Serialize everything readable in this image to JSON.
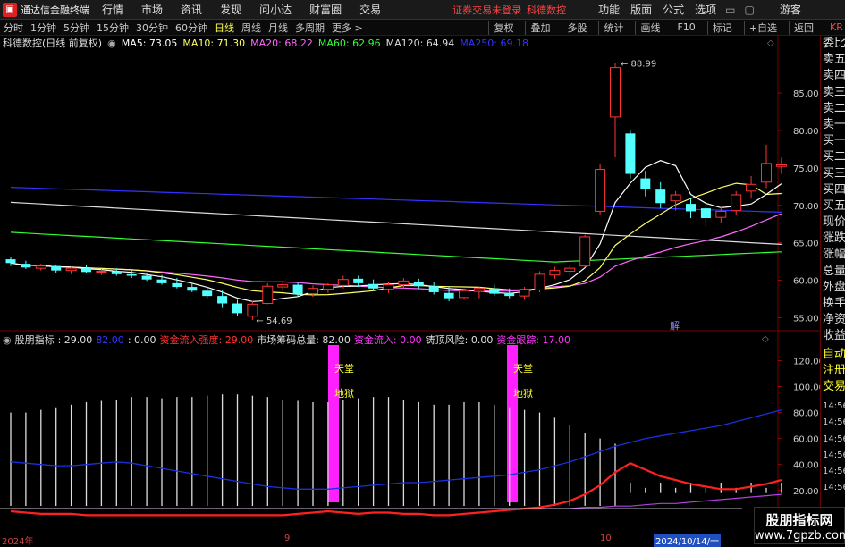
{
  "titlebar": {
    "app": "通达信金融终端",
    "menus": [
      "行情",
      "市场",
      "资讯",
      "发现",
      "问小达",
      "财富圈",
      "交易"
    ],
    "warning": "证券交易未登录",
    "stock": "科德数控",
    "right_menus": [
      "功能",
      "版面",
      "公式",
      "选项"
    ],
    "user": "游客"
  },
  "toolbar": {
    "periods": [
      "分时",
      "1分钟",
      "5分钟",
      "15分钟",
      "30分钟",
      "60分钟",
      "日线",
      "周线",
      "月线",
      "多周期",
      "更多 >"
    ],
    "active": "日线",
    "right_buttons": [
      "复权",
      "叠加",
      "多股",
      "统计",
      "画线",
      "F10",
      "标记",
      "+自选",
      "返回"
    ]
  },
  "info": {
    "name": "科德数控(日线 前复权)",
    "ma5": "MA5: 73.05",
    "ma10": "MA10: 71.30",
    "ma20": "MA20: 68.22",
    "ma60": "MA60: 62.96",
    "ma120": "MA120: 64.94",
    "ma250": "MA250: 69.18",
    "colors": {
      "ma5": "#ffffff",
      "ma10": "#ffff66",
      "ma20": "#ff66ff",
      "ma60": "#33ff33",
      "ma120": "#dddddd",
      "ma250": "#3333ff"
    }
  },
  "sidebar": {
    "labels": [
      "委比",
      "卖五",
      "卖四",
      "卖三",
      "卖二",
      "卖一",
      "买一",
      "买二",
      "买三",
      "买四",
      "买五",
      "现价",
      "涨跌",
      "涨幅",
      "总量",
      "外盘",
      "换手",
      "净资",
      "收益",
      "自动",
      "注册",
      "交易"
    ],
    "times": [
      "14:56",
      "14:56",
      "14:56",
      "14:56",
      "14:56",
      "14:56",
      "14:56",
      "14:56"
    ],
    "kr": "KR"
  },
  "indicator_bar": {
    "name": "股朋指标",
    "v1": ": 29.00",
    "v2": "82.00",
    "v3": ": 0.00",
    "t1": "资金流入强度: 29.00",
    "t2": "市场筹码总量: 82.00",
    "t3": "资金流入: 0.00",
    "t4": "铸顶风险: 0.00",
    "t5": "资金跟踪: 17.00"
  },
  "annotations": {
    "heaven": "天堂",
    "hell": "地狱",
    "hi": "88.99",
    "lo": "54.69",
    "jie": "解"
  },
  "bottom": {
    "year": "2024年",
    "sep": "9",
    "oct": "10",
    "date": "2024/10/14/一"
  },
  "watermark": {
    "line1": "股朋指标网",
    "line2": "www.7gpzb.com"
  },
  "chart_data": [
    {
      "type": "candlestick",
      "ylim": [
        53.5,
        90.5
      ],
      "yticks": [
        55.0,
        60.0,
        65.0,
        70.0,
        75.0,
        80.0,
        85.0
      ],
      "ohlc": [
        [
          62.8,
          63.1,
          61.9,
          62.3
        ],
        [
          62.2,
          62.6,
          61.5,
          61.7
        ],
        [
          61.6,
          62.2,
          61.3,
          61.9
        ],
        [
          61.9,
          62.1,
          61.0,
          61.3
        ],
        [
          61.3,
          61.8,
          60.8,
          61.6
        ],
        [
          61.6,
          62.0,
          60.9,
          61.1
        ],
        [
          61.1,
          61.5,
          60.7,
          61.2
        ],
        [
          61.2,
          61.6,
          60.6,
          60.8
        ],
        [
          60.8,
          61.4,
          60.3,
          60.6
        ],
        [
          60.6,
          61.0,
          59.9,
          60.1
        ],
        [
          60.1,
          60.7,
          59.4,
          59.6
        ],
        [
          59.6,
          60.3,
          58.9,
          59.1
        ],
        [
          59.1,
          59.6,
          58.4,
          58.6
        ],
        [
          58.6,
          59.1,
          57.6,
          57.9
        ],
        [
          57.9,
          58.6,
          56.3,
          56.9
        ],
        [
          56.9,
          57.4,
          55.2,
          55.6
        ],
        [
          55.2,
          57.2,
          54.7,
          56.8
        ],
        [
          56.9,
          59.6,
          56.8,
          59.2
        ],
        [
          59.1,
          59.9,
          58.6,
          59.4
        ],
        [
          59.4,
          59.7,
          57.9,
          58.1
        ],
        [
          58.2,
          59.3,
          57.8,
          58.9
        ],
        [
          58.8,
          59.6,
          58.3,
          59.4
        ],
        [
          59.3,
          60.6,
          58.9,
          60.1
        ],
        [
          60.2,
          60.6,
          59.1,
          59.6
        ],
        [
          59.5,
          60.1,
          58.6,
          58.9
        ],
        [
          58.8,
          59.8,
          58.3,
          59.4
        ],
        [
          59.4,
          60.3,
          58.9,
          59.9
        ],
        [
          59.8,
          60.2,
          58.9,
          59.2
        ],
        [
          59.2,
          59.8,
          58.1,
          58.4
        ],
        [
          58.3,
          59.2,
          57.2,
          57.6
        ],
        [
          57.7,
          58.9,
          57.4,
          58.6
        ],
        [
          58.5,
          59.1,
          57.6,
          58.9
        ],
        [
          58.9,
          59.4,
          57.9,
          58.2
        ],
        [
          58.3,
          58.9,
          57.6,
          57.9
        ],
        [
          57.9,
          59.1,
          57.4,
          58.8
        ],
        [
          58.7,
          61.2,
          58.4,
          60.8
        ],
        [
          60.7,
          61.8,
          60.2,
          61.3
        ],
        [
          61.2,
          62.1,
          60.6,
          61.6
        ],
        [
          61.9,
          66.1,
          61.7,
          65.8
        ],
        [
          69.2,
          75.6,
          68.8,
          74.8
        ],
        [
          81.8,
          88.99,
          76.4,
          88.4
        ],
        [
          79.6,
          80.1,
          73.6,
          74.2
        ],
        [
          73.6,
          74.6,
          71.2,
          72.2
        ],
        [
          72.1,
          73.1,
          69.6,
          70.3
        ],
        [
          70.6,
          71.9,
          69.3,
          71.4
        ],
        [
          70.2,
          71.0,
          68.3,
          69.2
        ],
        [
          69.6,
          70.1,
          67.2,
          68.3
        ],
        [
          68.4,
          69.9,
          67.7,
          69.2
        ],
        [
          69.3,
          71.9,
          68.7,
          71.4
        ],
        [
          71.9,
          73.9,
          70.9,
          72.8
        ],
        [
          73.1,
          78.1,
          72.3,
          75.6
        ],
        [
          75.2,
          76.4,
          74.2,
          75.4
        ]
      ]
    },
    {
      "type": "indicator",
      "ylim": [
        4.0,
        132.0
      ],
      "yticks": [
        20.0,
        40.0,
        60.0,
        80.0,
        100.0,
        120.0
      ],
      "bars": [
        80,
        80,
        82,
        84,
        86,
        88,
        89,
        90,
        92,
        92,
        91,
        92,
        92,
        93,
        94,
        94,
        93,
        92,
        90,
        89,
        88,
        88,
        90,
        91,
        92,
        92,
        90,
        88,
        86,
        86,
        88,
        88,
        86,
        84,
        82,
        80,
        76,
        70,
        64,
        60,
        56,
        4,
        4,
        4,
        4,
        4,
        4,
        4,
        4,
        4,
        4,
        4
      ],
      "blue": [
        42,
        41,
        40,
        39,
        39,
        40,
        41,
        42,
        41,
        39,
        37,
        35,
        33,
        31,
        29,
        27,
        25,
        23,
        22,
        21,
        21,
        21,
        22,
        23,
        24,
        25,
        26,
        26,
        27,
        28,
        29,
        30,
        31,
        32,
        34,
        36,
        39,
        42,
        46,
        50,
        54,
        57,
        60,
        62,
        64,
        66,
        68,
        70,
        73,
        76,
        79,
        82
      ],
      "red": [
        4,
        3,
        2,
        2,
        2,
        1,
        1,
        1,
        1,
        1,
        1,
        1,
        1,
        1,
        1,
        1,
        1,
        1,
        1,
        2,
        3,
        4,
        3,
        2,
        3,
        3,
        2,
        2,
        1,
        1,
        2,
        3,
        4,
        5,
        6,
        7,
        9,
        12,
        17,
        24,
        34,
        41,
        36,
        31,
        28,
        25,
        23,
        21,
        21,
        23,
        25,
        28,
        29,
        29
      ],
      "purple": [
        6,
        6,
        6,
        6,
        6,
        6,
        6,
        6,
        6,
        6,
        6,
        6,
        6,
        6,
        6,
        6,
        6,
        6,
        6,
        6,
        6,
        6,
        6,
        6,
        6,
        6,
        6,
        6,
        6,
        6,
        6,
        6,
        6,
        6,
        6,
        6,
        6,
        6,
        7,
        7,
        8,
        8,
        9,
        10,
        10,
        11,
        12,
        13,
        14,
        15,
        16,
        17
      ]
    }
  ]
}
